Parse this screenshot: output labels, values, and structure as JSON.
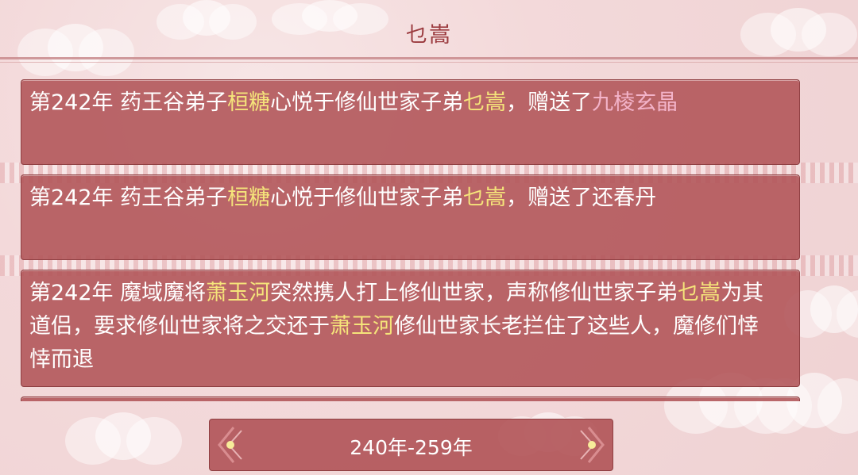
{
  "header": {
    "title": "乜嵩"
  },
  "events": [
    {
      "segments": [
        {
          "text": "第242年 药王谷弟子",
          "style": "plain"
        },
        {
          "text": "桓糖",
          "style": "yellow"
        },
        {
          "text": "心悦于修仙世家子弟",
          "style": "plain"
        },
        {
          "text": "乜嵩",
          "style": "yellow"
        },
        {
          "text": "，赠送了",
          "style": "plain"
        },
        {
          "text": "九棱玄晶",
          "style": "pink"
        }
      ]
    },
    {
      "segments": [
        {
          "text": "第242年 药王谷弟子",
          "style": "plain"
        },
        {
          "text": "桓糖",
          "style": "yellow"
        },
        {
          "text": "心悦于修仙世家子弟",
          "style": "plain"
        },
        {
          "text": "乜嵩",
          "style": "yellow"
        },
        {
          "text": "，赠送了还春丹",
          "style": "plain"
        }
      ]
    },
    {
      "segments": [
        {
          "text": "第242年 魔域魔将",
          "style": "plain"
        },
        {
          "text": "萧玉河",
          "style": "yellow"
        },
        {
          "text": "突然携人打上修仙世家，声称修仙世家子弟",
          "style": "plain"
        },
        {
          "text": "乜嵩",
          "style": "yellow"
        },
        {
          "text": "为其道侣，要求修仙世家将之交还于",
          "style": "plain"
        },
        {
          "text": "萧玉河",
          "style": "yellow"
        },
        {
          "text": "修仙世家长老拦住了这些人，魔修们悻悻而退",
          "style": "plain"
        }
      ]
    }
  ],
  "pager": {
    "label": "240年-259年",
    "prev_icon": "arrow-left-icon",
    "next_icon": "arrow-right-icon"
  },
  "colors": {
    "card": "#b05356",
    "highlight_name": "#f5e47a",
    "highlight_item": "#f3b3c9",
    "title": "#9b3b3f"
  }
}
